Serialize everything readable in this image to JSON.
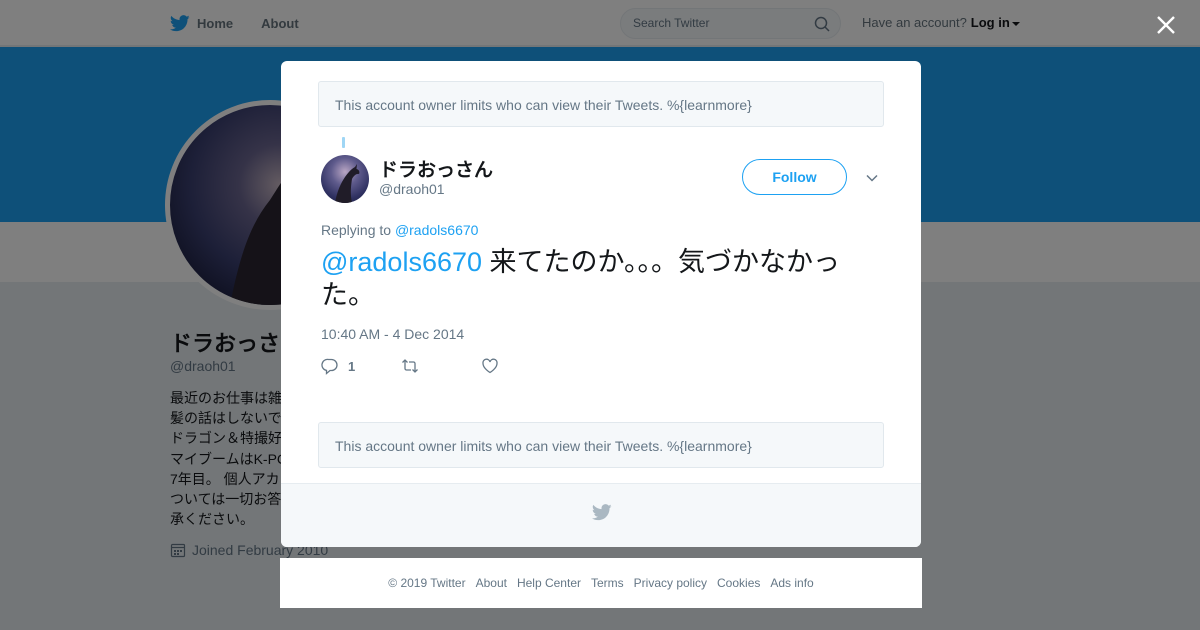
{
  "topbar": {
    "home_label": "Home",
    "about_label": "About",
    "search_placeholder": "Search Twitter",
    "account_prompt": "Have an account?",
    "login_label": "Log in"
  },
  "profile": {
    "name": "ドラおっさ",
    "handle": "@draoh01",
    "bio_lines": [
      "最近のお仕事は雑",
      "髪の話はしないで",
      "ドラゴン＆特撮好",
      "マイブームはK-PC",
      "7年目。 個人アカ",
      "ついては一切お答",
      "承ください。"
    ],
    "joined": "Joined February 2010"
  },
  "modal": {
    "notice": "This account owner limits who can view their Tweets. %{learnmore}",
    "tweet": {
      "author_name": "ドラおっさん",
      "author_handle": "@draoh01",
      "follow_label": "Follow",
      "replying_prefix": "Replying to",
      "replying_to": "@radols6670",
      "text_mention": "@radols6670",
      "text_body": " 来てたのか。。。気づかなかった。",
      "timestamp": "10:40 AM - 4 Dec 2014",
      "reply_count": "1"
    }
  },
  "footer": {
    "items": [
      "© 2019 Twitter",
      "About",
      "Help Center",
      "Terms",
      "Privacy policy",
      "Cookies",
      "Ads info"
    ]
  },
  "colors": {
    "accent": "#1da1f2",
    "text_primary": "#14171a",
    "text_secondary": "#657786",
    "banner": "#1da1f2"
  },
  "icons": [
    "twitter-bird-icon",
    "search-icon",
    "close-icon",
    "chevron-down-icon",
    "reply-icon",
    "retweet-icon",
    "like-icon",
    "calendar-icon"
  ]
}
